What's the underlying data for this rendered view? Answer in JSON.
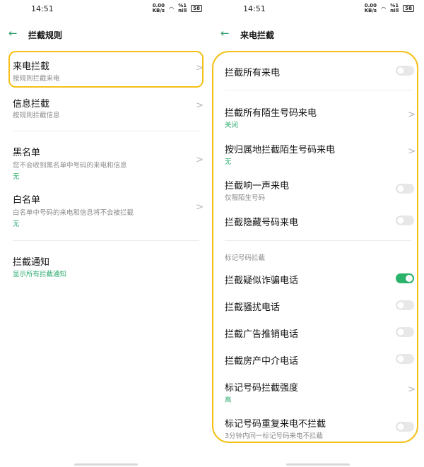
{
  "left": {
    "status": {
      "time": "14:51",
      "net": "0.00\nKB/s",
      "signal": "%1\nnill",
      "battery": "58"
    },
    "title": "拦截规则",
    "items": [
      {
        "title": "来电拦截",
        "sub": "按规则拦截来电",
        "status": ""
      },
      {
        "title": "信息拦截",
        "sub": "按规则拦截信息",
        "status": ""
      },
      {
        "title": "黑名单",
        "sub": "您不会收到黑名单中号码的来电和信息",
        "status": "无"
      },
      {
        "title": "白名单",
        "sub": "白名单中号码的来电和信息将不会被拦截",
        "status": "无"
      },
      {
        "title": "拦截通知",
        "sub": "",
        "status": "显示所有拦截通知"
      }
    ]
  },
  "right": {
    "status": {
      "time": "14:51",
      "net": "0.00\nKB/s",
      "signal": "%1\nnill",
      "battery": "58"
    },
    "title": "来电拦截",
    "items": [
      {
        "title": "拦截所有来电",
        "sub": "",
        "status": "",
        "control": "toggle",
        "on": false
      },
      {
        "title": "拦截所有陌生号码来电",
        "sub": "",
        "status": "关闭",
        "control": "chevron"
      },
      {
        "title": "按归属地拦截陌生号码来电",
        "sub": "",
        "status": "无",
        "control": "chevron"
      },
      {
        "title": "拦截响一声来电",
        "sub": "仅限陌生号码",
        "status": "",
        "control": "toggle",
        "on": false
      },
      {
        "title": "拦截隐藏号码来电",
        "sub": "",
        "status": "",
        "control": "toggle",
        "on": false
      },
      {
        "title": "拦截疑似诈骗电话",
        "sub": "",
        "status": "",
        "control": "toggle",
        "on": true
      },
      {
        "title": "拦截骚扰电话",
        "sub": "",
        "status": "",
        "control": "toggle",
        "on": false
      },
      {
        "title": "拦截广告推销电话",
        "sub": "",
        "status": "",
        "control": "toggle",
        "on": false
      },
      {
        "title": "拦截房产中介电话",
        "sub": "",
        "status": "",
        "control": "toggle",
        "on": false
      },
      {
        "title": "标记号码拦截强度",
        "sub": "",
        "status": "高",
        "control": "chevron"
      },
      {
        "title": "标记号码重复来电不拦截",
        "sub": "3分钟内同一标记号码来电不拦截",
        "status": "",
        "control": "toggle",
        "on": false
      }
    ],
    "section_label": "标记号码拦截"
  },
  "colors": {
    "accent": "#2bb36c",
    "highlight": "#f5c018"
  },
  "icons": {
    "back": "back-arrow-icon",
    "chevron": "chevron-right-icon"
  }
}
